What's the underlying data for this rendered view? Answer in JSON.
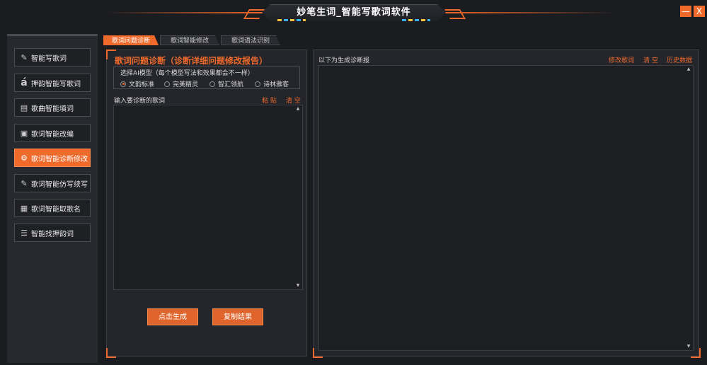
{
  "window": {
    "title": "妙笔生词_智能写歌词软件",
    "min_label": "—",
    "close_label": "X",
    "accent_color": "#f06a2c"
  },
  "sidebar": {
    "items": [
      {
        "label": "智能写歌词",
        "icon": "pen-icon",
        "active": false
      },
      {
        "label": "押韵智能写歌词",
        "icon": "rhyme-a-icon",
        "active": false
      },
      {
        "label": "歌曲智能填词",
        "icon": "document-icon",
        "active": false
      },
      {
        "label": "歌词智能改编",
        "icon": "edit-box-icon",
        "active": false
      },
      {
        "label": "歌词智能诊断修改",
        "icon": "diagnose-icon",
        "active": true
      },
      {
        "label": "歌词智能仿写续写",
        "icon": "pen-icon",
        "active": false
      },
      {
        "label": "歌词智能取歌名",
        "icon": "tag-icon",
        "active": false
      },
      {
        "label": "智能找押韵词",
        "icon": "sliders-icon",
        "active": false
      }
    ]
  },
  "tabs": [
    {
      "label": "歌词问题诊断",
      "active": true
    },
    {
      "label": "歌词智能修改",
      "active": false
    },
    {
      "label": "歌词语法识别",
      "active": false
    }
  ],
  "left": {
    "title": "歌词问题诊断（诊断详细问题修改报告）",
    "model_label": "选择AI模型（每个模型写法和效果都会不一样）",
    "models": [
      {
        "label": "文韵标准",
        "selected": true
      },
      {
        "label": "完美精灵",
        "selected": false
      },
      {
        "label": "智汇领航",
        "selected": false
      },
      {
        "label": "诗林雅客",
        "selected": false
      }
    ],
    "input_label": "输入要诊断的歌词",
    "paste_label": "粘 贴",
    "clear_label": "清 空",
    "input_value": "",
    "generate_label": "点击生成",
    "copy_label": "复制结果"
  },
  "right": {
    "result_label": "以下为生成诊断报",
    "optimize_label": "修改歌词",
    "clear_label": "清 空",
    "history_label": "历史数据",
    "output_value": ""
  }
}
